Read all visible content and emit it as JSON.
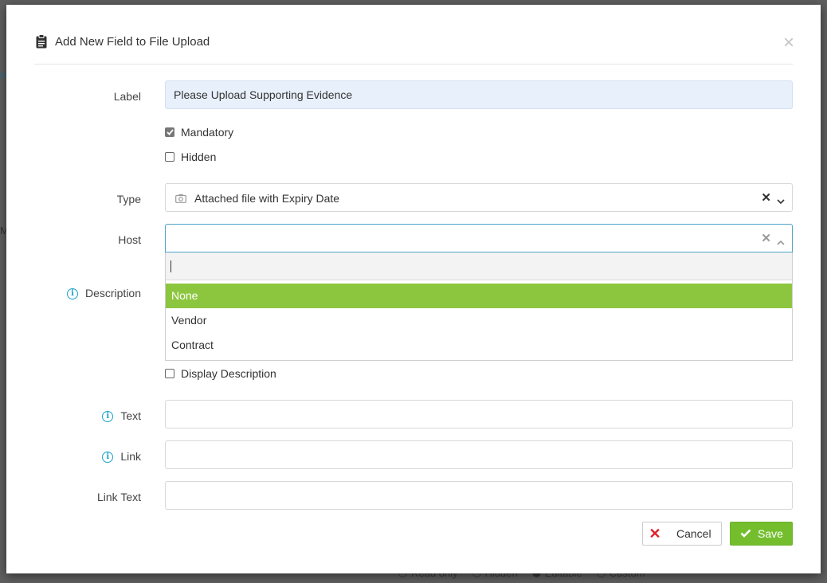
{
  "modal": {
    "title": "Add New Field to File Upload",
    "title_icon": "clipboard-icon",
    "close_icon": "close-icon"
  },
  "form": {
    "label": {
      "label": "Label",
      "value": "Please Upload Supporting Evidence"
    },
    "mandatory": {
      "label": "Mandatory",
      "checked": true
    },
    "hidden": {
      "label": "Hidden",
      "checked": false
    },
    "type": {
      "label": "Type",
      "value": "Attached file with Expiry Date",
      "icon": "camera-icon"
    },
    "host": {
      "label": "Host",
      "value": "",
      "search_value": "",
      "options": [
        "None",
        "Vendor",
        "Contract"
      ],
      "highlighted": "None"
    },
    "description": {
      "label": "Description",
      "info_icon": "info-icon"
    },
    "display_description": {
      "label": "Display Description",
      "checked": false
    },
    "text": {
      "label": "Text",
      "value": ""
    },
    "link": {
      "label": "Link",
      "value": ""
    },
    "link_text": {
      "label": "Link Text",
      "value": ""
    }
  },
  "buttons": {
    "cancel": "Cancel",
    "save": "Save"
  },
  "background": {
    "radio_options": [
      "Read only",
      "Hidden",
      "Editable",
      "Custom"
    ],
    "radio_selected": "Editable"
  },
  "colors": {
    "accent_green": "#8cc63f",
    "save_green": "#74be2e",
    "info_blue": "#1aa1c8",
    "cancel_red": "#e0212a",
    "filled_input_bg": "#e8f0fb"
  }
}
